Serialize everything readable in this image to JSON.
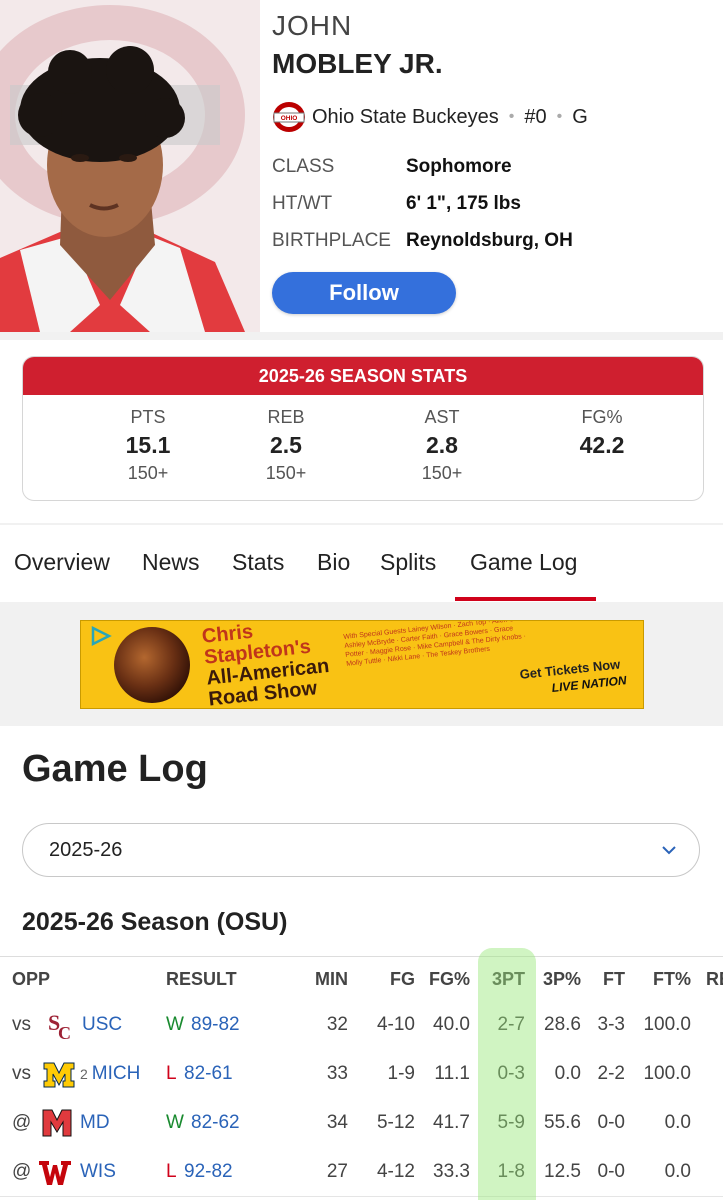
{
  "player": {
    "first_name": "JOHN",
    "last_name": "MOBLEY JR.",
    "team": "Ohio State Buckeyes",
    "number": "#0",
    "position": "G",
    "team_logo_text": "OHIO STATE",
    "follow_label": "Follow",
    "bio": [
      {
        "label": "CLASS",
        "value": "Sophomore"
      },
      {
        "label": "HT/WT",
        "value": "6' 1\", 175 lbs"
      },
      {
        "label": "BIRTHPLACE",
        "value": "Reynoldsburg, OH"
      }
    ]
  },
  "season_stats": {
    "title": "2025-26 SEASON STATS",
    "stats": [
      {
        "label": "PTS",
        "value": "15.1",
        "rank": "150+"
      },
      {
        "label": "REB",
        "value": "2.5",
        "rank": "150+"
      },
      {
        "label": "AST",
        "value": "2.8",
        "rank": "150+"
      },
      {
        "label": "FG%",
        "value": "42.2",
        "rank": ""
      }
    ]
  },
  "tabs": [
    {
      "label": "Overview",
      "active": false
    },
    {
      "label": "News",
      "active": false
    },
    {
      "label": "Stats",
      "active": false
    },
    {
      "label": "Bio",
      "active": false
    },
    {
      "label": "Splits",
      "active": false
    },
    {
      "label": "Game Log",
      "active": true
    }
  ],
  "ad": {
    "title_line1": "Chris",
    "title_line2": "Stapleton's",
    "title_line3": "All-American",
    "title_line4": "Road Show",
    "guests": "With Special Guests Lainey Wilson · Zach Top · Allen Stone · Ashley McBryde · Carter Faith · Grace Bowers · Grace Potter · Maggie Rose · Mike Campbell & The Dirty Knobs · Molly Tuttle · Nikki Lane · The Teskey Brothers",
    "cta": "Get Tickets Now",
    "sponsor": "LIVE NATION",
    "colors": {
      "bg": "#f9c214",
      "text": "#c0351b"
    }
  },
  "game_log": {
    "title": "Game Log",
    "season_select": "2025-26",
    "season_heading": "2025-26 Season (OSU)",
    "columns": [
      "OPP",
      "RESULT",
      "MIN",
      "FG",
      "FG%",
      "3PT",
      "3P%",
      "FT",
      "FT%",
      "RE"
    ],
    "rows": [
      {
        "prefix": "vs",
        "rank": "",
        "opp": "USC",
        "logo": "usc-logo",
        "wl": "W",
        "score": "89-82",
        "min": "32",
        "fg": "4-10",
        "fg_pct": "40.0",
        "three": "2-7",
        "three_pct": "28.6",
        "ft": "3-3",
        "ft_pct": "100.0"
      },
      {
        "prefix": "vs",
        "rank": "2",
        "opp": "MICH",
        "logo": "michigan-logo",
        "wl": "L",
        "score": "82-61",
        "min": "33",
        "fg": "1-9",
        "fg_pct": "11.1",
        "three": "0-3",
        "three_pct": "0.0",
        "ft": "2-2",
        "ft_pct": "100.0"
      },
      {
        "prefix": "@",
        "rank": "",
        "opp": "MD",
        "logo": "maryland-logo",
        "wl": "W",
        "score": "82-62",
        "min": "34",
        "fg": "5-12",
        "fg_pct": "41.7",
        "three": "5-9",
        "three_pct": "55.6",
        "ft": "0-0",
        "ft_pct": "0.0"
      },
      {
        "prefix": "@",
        "rank": "",
        "opp": "WIS",
        "logo": "wisconsin-logo",
        "wl": "L",
        "score": "92-82",
        "min": "27",
        "fg": "4-12",
        "fg_pct": "33.3",
        "three": "1-8",
        "three_pct": "12.5",
        "ft": "0-0",
        "ft_pct": "0.0"
      }
    ],
    "highlight_color": "#96e678"
  },
  "colors": {
    "accent": "#cf1f2f",
    "follow": "#3470dc",
    "win": "#198a2f",
    "loss": "#d0021b",
    "link": "#2a63b8"
  }
}
